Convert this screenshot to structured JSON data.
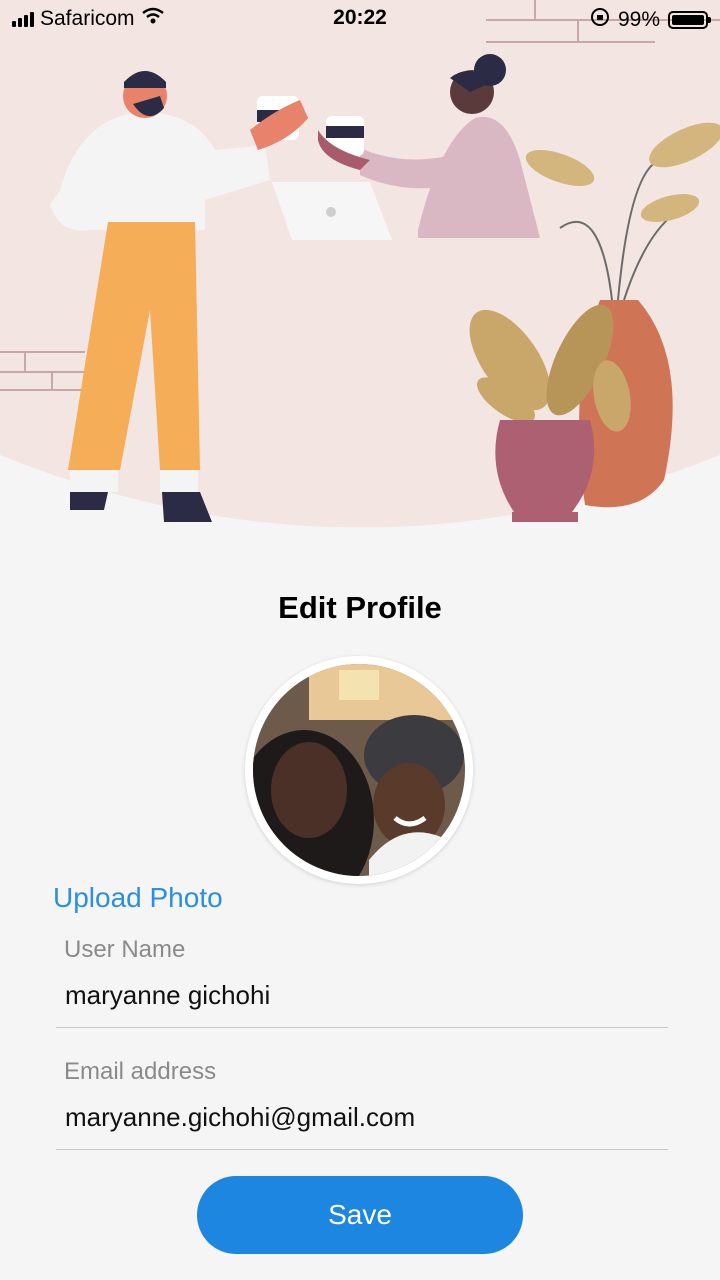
{
  "status_bar": {
    "carrier": "Safaricom",
    "time": "20:22",
    "battery_percent": "99%",
    "battery_level": 0.99,
    "icons": [
      "signal-icon",
      "wifi-icon",
      "orientation-lock-icon",
      "battery-icon"
    ]
  },
  "page": {
    "title": "Edit Profile",
    "upload_label": "Upload Photo"
  },
  "form": {
    "username": {
      "label": "User Name",
      "value": "maryanne gichohi"
    },
    "email": {
      "label": "Email address",
      "value": "maryanne.gichohi@gmail.com"
    },
    "save_label": "Save"
  },
  "colors": {
    "accent": "#1c86e0",
    "link": "#2a8fe0",
    "hero_background": "#f3e5e1",
    "page_background": "#f5f5f5"
  }
}
